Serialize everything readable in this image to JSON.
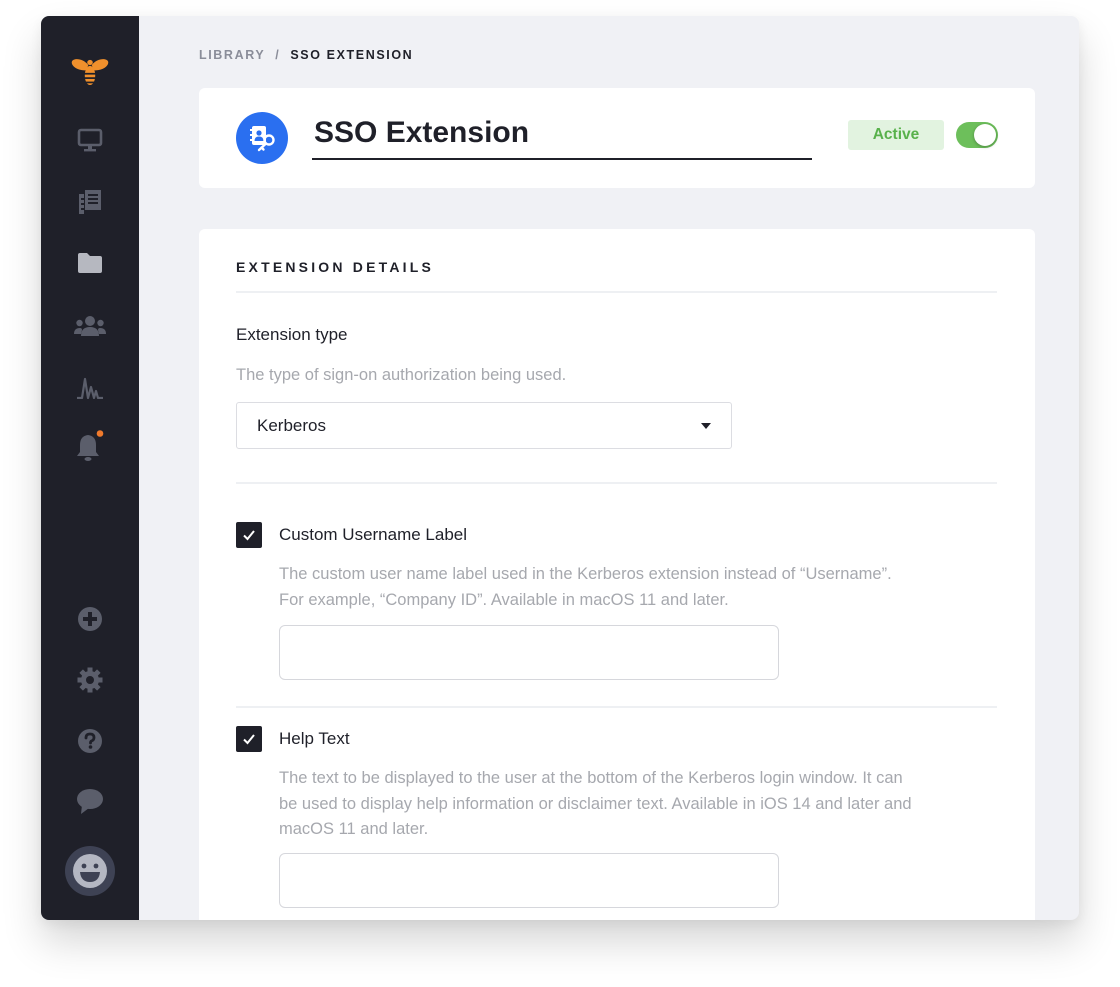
{
  "sidebar": {
    "logo": "bee-logo-icon",
    "nav_items": [
      {
        "icon": "computer-icon",
        "name": "devices"
      },
      {
        "icon": "blueprints-icon",
        "name": "blueprints"
      },
      {
        "icon": "folder-icon",
        "name": "library"
      },
      {
        "icon": "users-icon",
        "name": "users"
      },
      {
        "icon": "activity-icon",
        "name": "activity"
      },
      {
        "icon": "bell-icon",
        "name": "alerts",
        "has_notification": true
      }
    ],
    "bottom_items": [
      {
        "icon": "plus-circle-icon",
        "name": "add"
      },
      {
        "icon": "gear-icon",
        "name": "settings"
      },
      {
        "icon": "help-icon",
        "name": "help"
      },
      {
        "icon": "chat-icon",
        "name": "chat"
      }
    ],
    "avatar": "smiley-avatar-icon",
    "colors": {
      "background": "#1f2029",
      "icon": "#5b5e6b",
      "logo": "#f0902c",
      "notification": "#f07a2c"
    }
  },
  "breadcrumb": {
    "items": [
      "LIBRARY",
      "SSO EXTENSION"
    ],
    "separator": "/"
  },
  "header": {
    "icon": "contact-key-icon",
    "title": "SSO Extension",
    "status_badge": "Active",
    "toggle_on": true,
    "colors": {
      "icon_bg": "#2a6ff0",
      "badge_bg": "#e2f3e0",
      "badge_text": "#58b14b",
      "toggle": "#6dbf5b"
    }
  },
  "details": {
    "section_title": "EXTENSION DETAILS",
    "extension_type": {
      "label": "Extension type",
      "help": "The type of sign-on authorization being used.",
      "selected": "Kerberos"
    },
    "fields": [
      {
        "label": "Custom Username Label",
        "checked": true,
        "help_lines": [
          "The custom user name label used in the Kerberos extension instead of “Username”.",
          "For example, “Company ID”. Available in macOS 11 and later."
        ],
        "value": ""
      },
      {
        "label": "Help Text",
        "checked": true,
        "help_lines": [
          "The text to be displayed to the user at the bottom of the Kerberos login window. It can",
          "be used to display help information or disclaimer text. Available in iOS 14 and later and",
          "macOS 11 and later."
        ],
        "value": ""
      }
    ]
  }
}
